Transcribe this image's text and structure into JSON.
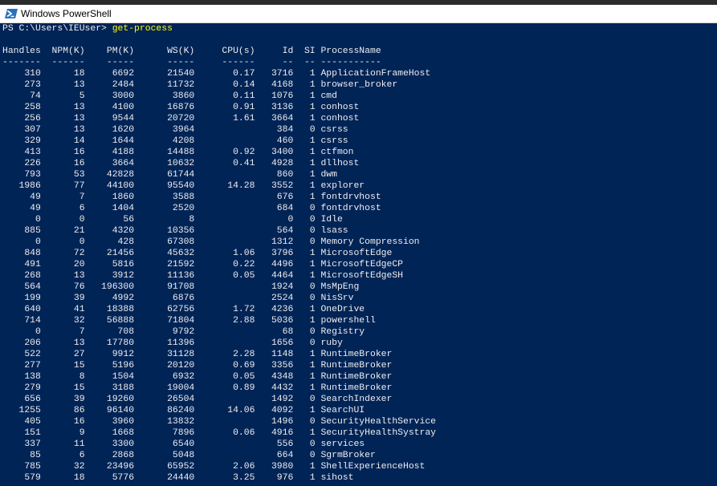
{
  "window": {
    "title": "Windows PowerShell"
  },
  "colors": {
    "background": "#012456",
    "text": "#eeedf0",
    "command": "#ffff00"
  },
  "icons": {
    "title_icon": "powershell-icon"
  },
  "console": {
    "prompt": "PS C:\\Users\\IEUser> ",
    "command": "get-process",
    "header": "Handles  NPM(K)    PM(K)      WS(K)     CPU(s)     Id  SI ProcessName",
    "separator": "-------  ------    -----      -----     ------     --  -- -----------",
    "rows": [
      "    310      18     6692      21540       0.17   3716   1 ApplicationFrameHost",
      "    273      13     2484      11732       0.14   4168   1 browser_broker",
      "     74       5     3000       3860       0.11   1076   1 cmd",
      "    258      13     4100      16876       0.91   3136   1 conhost",
      "    256      13     9544      20720       1.61   3664   1 conhost",
      "    307      13     1620       3964               384   0 csrss",
      "    329      14     1644       4208               460   1 csrss",
      "    413      16     4188      14488       0.92   3400   1 ctfmon",
      "    226      16     3664      10632       0.41   4928   1 dllhost",
      "    793      53    42828      61744               860   1 dwm",
      "   1986      77    44100      95540      14.28   3552   1 explorer",
      "     49       7     1860       3588               676   1 fontdrvhost",
      "     49       6     1404       2520               684   0 fontdrvhost",
      "      0       0       56          8                 0   0 Idle",
      "    885      21     4320      10356               564   0 lsass",
      "      0       0      428      67308              1312   0 Memory Compression",
      "    848      72    21456      45632       1.06   3796   1 MicrosoftEdge",
      "    491      20     5816      21592       0.22   4496   1 MicrosoftEdgeCP",
      "    268      13     3912      11136       0.05   4464   1 MicrosoftEdgeSH",
      "    564      76   196300      91708              1924   0 MsMpEng",
      "    199      39     4992       6876              2524   0 NisSrv",
      "    640      41    18388      62756       1.72   4236   1 OneDrive",
      "    714      32    56888      71804       2.88   5036   1 powershell",
      "      0       7      708       9792                68   0 Registry",
      "    206      13    17780      11396              1656   0 ruby",
      "    522      27     9912      31128       2.28   1148   1 RuntimeBroker",
      "    277      15     5196      20120       0.69   3356   1 RuntimeBroker",
      "    138       8     1504       6932       0.05   4348   1 RuntimeBroker",
      "    279      15     3188      19004       0.89   4432   1 RuntimeBroker",
      "    656      39    19260      26504              1492   0 SearchIndexer",
      "   1255      86    96140      86240      14.06   4092   1 SearchUI",
      "    405      16     3960      13832              1496   0 SecurityHealthService",
      "    151       9     1668       7896       0.06   4916   1 SecurityHealthSystray",
      "    337      11     3300       6540               556   0 services",
      "     85       6     2868       5048               664   0 SgrmBroker",
      "    785      32    23496      65952       2.06   3980   1 ShellExperienceHost",
      "    579      18     5776      24440       3.25    976   1 sihost"
    ]
  }
}
